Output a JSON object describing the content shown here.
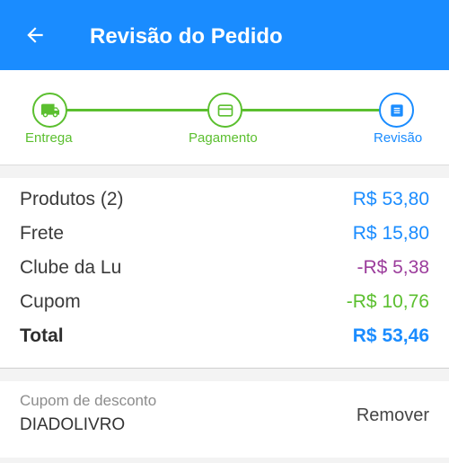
{
  "header": {
    "title": "Revisão do Pedido",
    "background_color": "#1a8cff",
    "back_icon": "arrow-left-icon"
  },
  "stepper": {
    "steps": [
      {
        "label": "Entrega",
        "icon": "truck-icon",
        "state": "done"
      },
      {
        "label": "Pagamento",
        "icon": "credit-card-icon",
        "state": "done"
      },
      {
        "label": "Revisão",
        "icon": "list-icon",
        "state": "active"
      }
    ],
    "done_color": "#5bbf2f",
    "active_color": "#1a8cff"
  },
  "summary": {
    "rows": [
      {
        "label": "Produtos (2)",
        "value": "R$ 53,80",
        "color": "#1a8cff"
      },
      {
        "label": "Frete",
        "value": "R$ 15,80",
        "color": "#1a8cff"
      },
      {
        "label": "Clube da Lu",
        "value": "-R$ 5,38",
        "color": "#9c3d9c"
      },
      {
        "label": "Cupom",
        "value": "-R$ 10,76",
        "color": "#5bbf2f"
      }
    ],
    "total": {
      "label": "Total",
      "value": "R$ 53,46",
      "color": "#1a8cff"
    }
  },
  "coupon": {
    "caption": "Cupom de desconto",
    "code": "DIADOLIVRO",
    "remove_label": "Remover"
  }
}
